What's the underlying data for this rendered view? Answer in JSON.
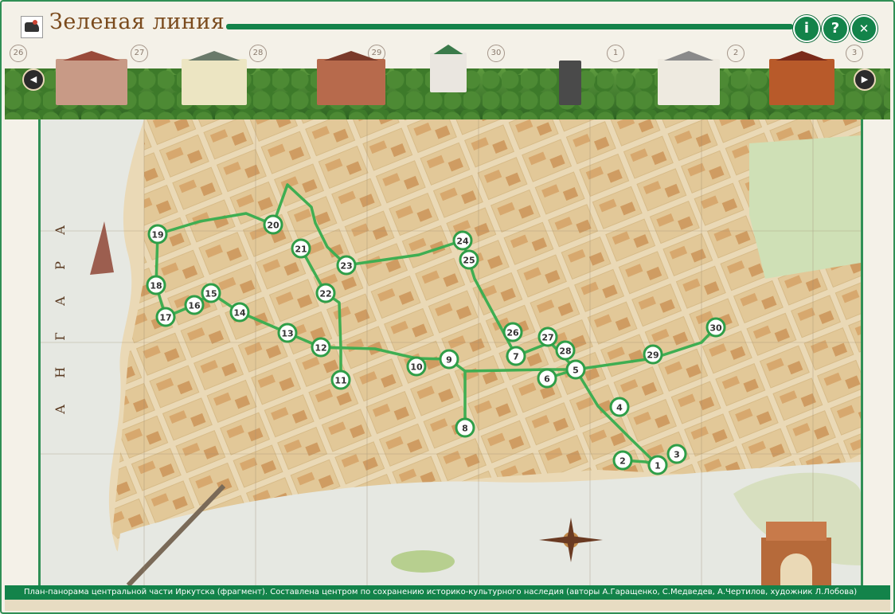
{
  "header": {
    "title": "Зеленая линия",
    "info_label": "i",
    "help_label": "?",
    "close_label": "✕",
    "prev_label": "◀",
    "next_label": "▶"
  },
  "carousel_numbers": [
    "26",
    "27",
    "28",
    "29",
    "30",
    "1",
    "2",
    "3"
  ],
  "caption": "План-панорама центральной части Иркутска (фрагмент). Составлена центром по сохранению историко-культурного наследия (авторы А.Гаращенко, С.Медведев, А.Чертилов, художник Л.Лобова)",
  "colors": {
    "accent": "#13834a",
    "title": "#7a4a1c",
    "river": "#e6e8e2",
    "route": "#3fae52"
  },
  "river_text": "А Н Г А Р А",
  "markers": [
    {
      "label": "1"
    },
    {
      "label": "2"
    },
    {
      "label": "3"
    },
    {
      "label": "4"
    },
    {
      "label": "5"
    },
    {
      "label": "6"
    },
    {
      "label": "7"
    },
    {
      "label": "8"
    },
    {
      "label": "9"
    },
    {
      "label": "10"
    },
    {
      "label": "11"
    },
    {
      "label": "12"
    },
    {
      "label": "13"
    },
    {
      "label": "14"
    },
    {
      "label": "15"
    },
    {
      "label": "16"
    },
    {
      "label": "17"
    },
    {
      "label": "18"
    },
    {
      "label": "19"
    },
    {
      "label": "20"
    },
    {
      "label": "21"
    },
    {
      "label": "22"
    },
    {
      "label": "23"
    },
    {
      "label": "24"
    },
    {
      "label": "25"
    },
    {
      "label": "26"
    },
    {
      "label": "27"
    },
    {
      "label": "28"
    },
    {
      "label": "29"
    },
    {
      "label": "30"
    }
  ]
}
